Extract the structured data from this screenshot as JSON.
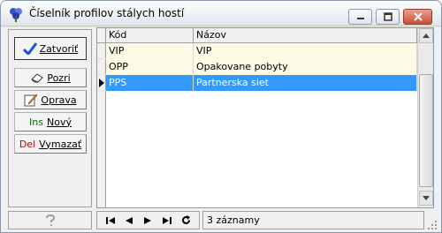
{
  "window": {
    "title": "Číselník profilov stálych hostí",
    "icons": [
      "app-icon",
      "minimize-icon",
      "maximize-icon",
      "close-icon"
    ]
  },
  "toolbar": {
    "close": {
      "label": "Zatvoriť",
      "icon": "checkmark-icon"
    },
    "view": {
      "label": "Pozri",
      "icon": "eraser-icon"
    },
    "edit": {
      "label": "Oprava",
      "icon": "pencil-icon"
    },
    "new": {
      "key": "Ins",
      "label": "Nový",
      "key_color": "#007000"
    },
    "delete": {
      "key": "Del",
      "label": "Vymazať",
      "key_color": "#c00000"
    }
  },
  "grid": {
    "columns": [
      "Kód",
      "Názov"
    ],
    "rows": [
      {
        "kod": "VIP",
        "nazov": "VIP",
        "selected": false
      },
      {
        "kod": "OPP",
        "nazov": "Opakovane pobyty",
        "selected": false
      },
      {
        "kod": "PPS",
        "nazov": "Partnerska siet",
        "selected": true
      }
    ],
    "selection_color": "#3399ff",
    "row_color": "#fdfbe6"
  },
  "status": {
    "help_icon": "question-icon",
    "nav_icons": [
      "first-record-icon",
      "prev-record-icon",
      "next-record-icon",
      "last-record-icon",
      "refresh-icon"
    ],
    "record_count": "3 záznamy"
  }
}
